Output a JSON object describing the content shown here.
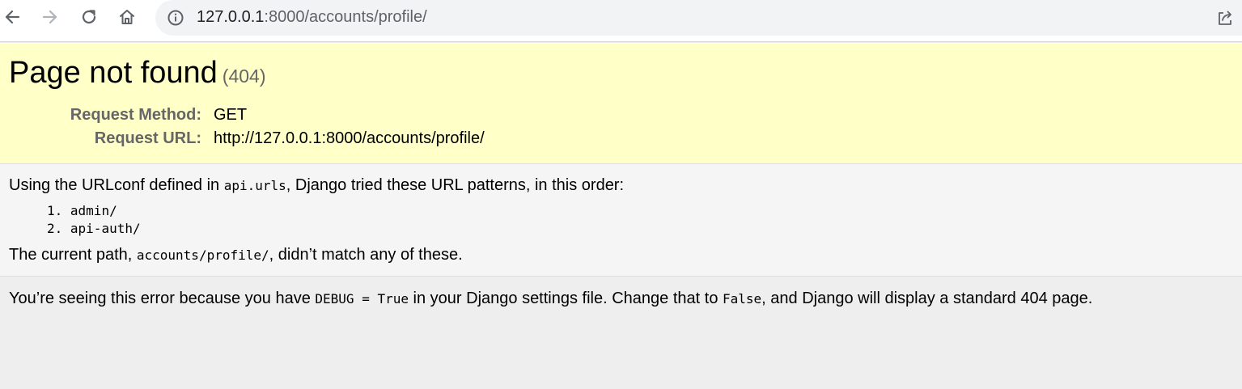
{
  "browser": {
    "back_icon": "arrow-left-icon",
    "forward_icon": "arrow-right-icon",
    "reload_icon": "reload-icon",
    "home_icon": "home-icon",
    "site_info_icon": "info-circle-icon",
    "share_icon": "share-icon",
    "url_host": "127.0.0.1",
    "url_rest": ":8000/accounts/profile/"
  },
  "summary": {
    "title": "Page not found",
    "status": "(404)",
    "rows": [
      {
        "key": "Request Method:",
        "value": "GET"
      },
      {
        "key": "Request URL:",
        "value": "http://127.0.0.1:8000/accounts/profile/"
      }
    ]
  },
  "info": {
    "intro_prefix": "Using the URLconf defined in ",
    "urlconf": "api.urls",
    "intro_suffix": ", Django tried these URL patterns, in this order:",
    "patterns": [
      {
        "num": "1.",
        "pattern": "admin/"
      },
      {
        "num": "2.",
        "pattern": "api-auth/"
      }
    ],
    "path_prefix": "The current path, ",
    "path": "accounts/profile/",
    "path_suffix": ", didn’t match any of these."
  },
  "explanation": {
    "part1": "You’re seeing this error because you have ",
    "code1": "DEBUG = True",
    "part2": " in your Django settings file. Change that to ",
    "code2": "False",
    "part3": ", and Django will display a standard 404 page."
  },
  "colors": {
    "summary_bg": "#ffffc8",
    "info_bg": "#f5f5f5",
    "explanation_bg": "#eeeeee"
  }
}
